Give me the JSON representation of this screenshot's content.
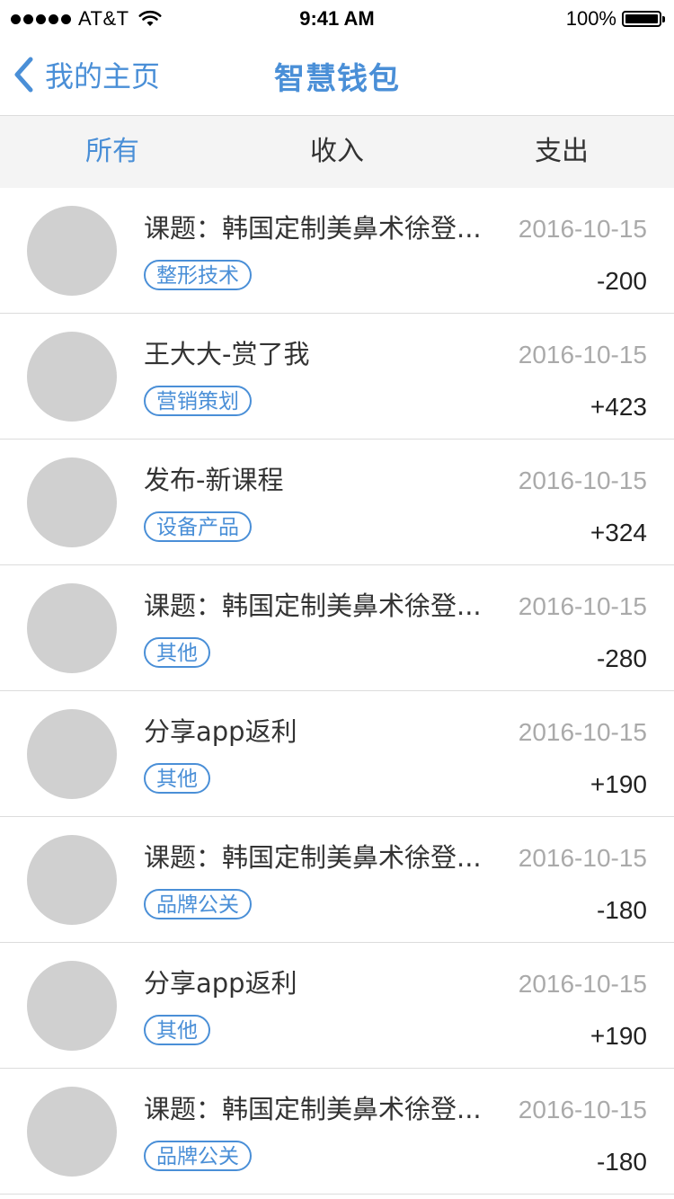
{
  "status": {
    "carrier": "AT&T",
    "time": "9:41 AM",
    "battery": "100%"
  },
  "nav": {
    "back_label": "我的主页",
    "title": "智慧钱包"
  },
  "tabs": [
    {
      "label": "所有",
      "active": true
    },
    {
      "label": "收入",
      "active": false
    },
    {
      "label": "支出",
      "active": false
    }
  ],
  "records": [
    {
      "title": "课题：韩国定制美鼻术徐登...",
      "tag": "整形技术",
      "date": "2016-10-15",
      "amount": "-200"
    },
    {
      "title": "王大大-赏了我",
      "tag": "营销策划",
      "date": "2016-10-15",
      "amount": "+423"
    },
    {
      "title": "发布-新课程",
      "tag": "设备产品",
      "date": "2016-10-15",
      "amount": "+324"
    },
    {
      "title": "课题：韩国定制美鼻术徐登...",
      "tag": "其他",
      "date": "2016-10-15",
      "amount": "-280"
    },
    {
      "title": "分享app返利",
      "tag": "其他",
      "date": "2016-10-15",
      "amount": "+190"
    },
    {
      "title": "课题：韩国定制美鼻术徐登...",
      "tag": "品牌公关",
      "date": "2016-10-15",
      "amount": "-180"
    },
    {
      "title": "分享app返利",
      "tag": "其他",
      "date": "2016-10-15",
      "amount": "+190"
    },
    {
      "title": "课题：韩国定制美鼻术徐登...",
      "tag": "品牌公关",
      "date": "2016-10-15",
      "amount": "-180"
    }
  ],
  "colors": {
    "accent": "#4a8fd7",
    "tab_bg": "#f4f4f4",
    "avatar": "#d0d0d0"
  }
}
